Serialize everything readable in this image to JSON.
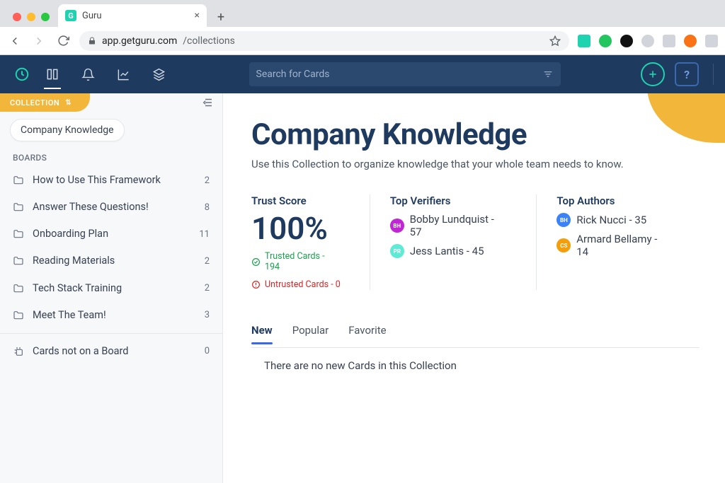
{
  "browser": {
    "tab_title": "Guru",
    "url_domain": "app.getguru.com",
    "url_path": "/collections"
  },
  "nav": {
    "search_placeholder": "Search for Cards",
    "help_label": "?"
  },
  "sidebar": {
    "section_label": "COLLECTION",
    "collection_name": "Company Knowledge",
    "boards_label": "BOARDS",
    "boards": [
      {
        "label": "How to Use This Framework",
        "count": "2"
      },
      {
        "label": "Answer These Questions!",
        "count": "8"
      },
      {
        "label": "Onboarding Plan",
        "count": "11"
      },
      {
        "label": "Reading Materials",
        "count": "2"
      },
      {
        "label": "Tech Stack Training",
        "count": "2"
      },
      {
        "label": "Meet The Team!",
        "count": "3"
      }
    ],
    "unboarded": {
      "label": "Cards not on a Board",
      "count": "0"
    }
  },
  "main": {
    "title": "Company Knowledge",
    "subtitle": "Use this Collection to organize knowledge that your whole team needs to know.",
    "trust": {
      "label": "Trust Score",
      "value": "100%",
      "trusted_text": "Trusted Cards - 194",
      "untrusted_text": "Untrusted Cards - 0"
    },
    "verifiers": {
      "label": "Top Verifiers",
      "people": [
        {
          "initials": "BH",
          "color": "#c026d3",
          "text": "Bobby Lundquist - 57"
        },
        {
          "initials": "PR",
          "color": "#5eead4",
          "text": "Jess Lantis  - 45"
        }
      ]
    },
    "authors": {
      "label": "Top Authors",
      "people": [
        {
          "initials": "BH",
          "color": "#3b82f6",
          "text": "Rick Nucci - 35"
        },
        {
          "initials": "CS",
          "color": "#f59e0b",
          "text": "Armard Bellamy - 14"
        }
      ]
    },
    "tabs": [
      "New",
      "Popular",
      "Favorite"
    ],
    "empty_message": "There are no new Cards in this Collection"
  }
}
